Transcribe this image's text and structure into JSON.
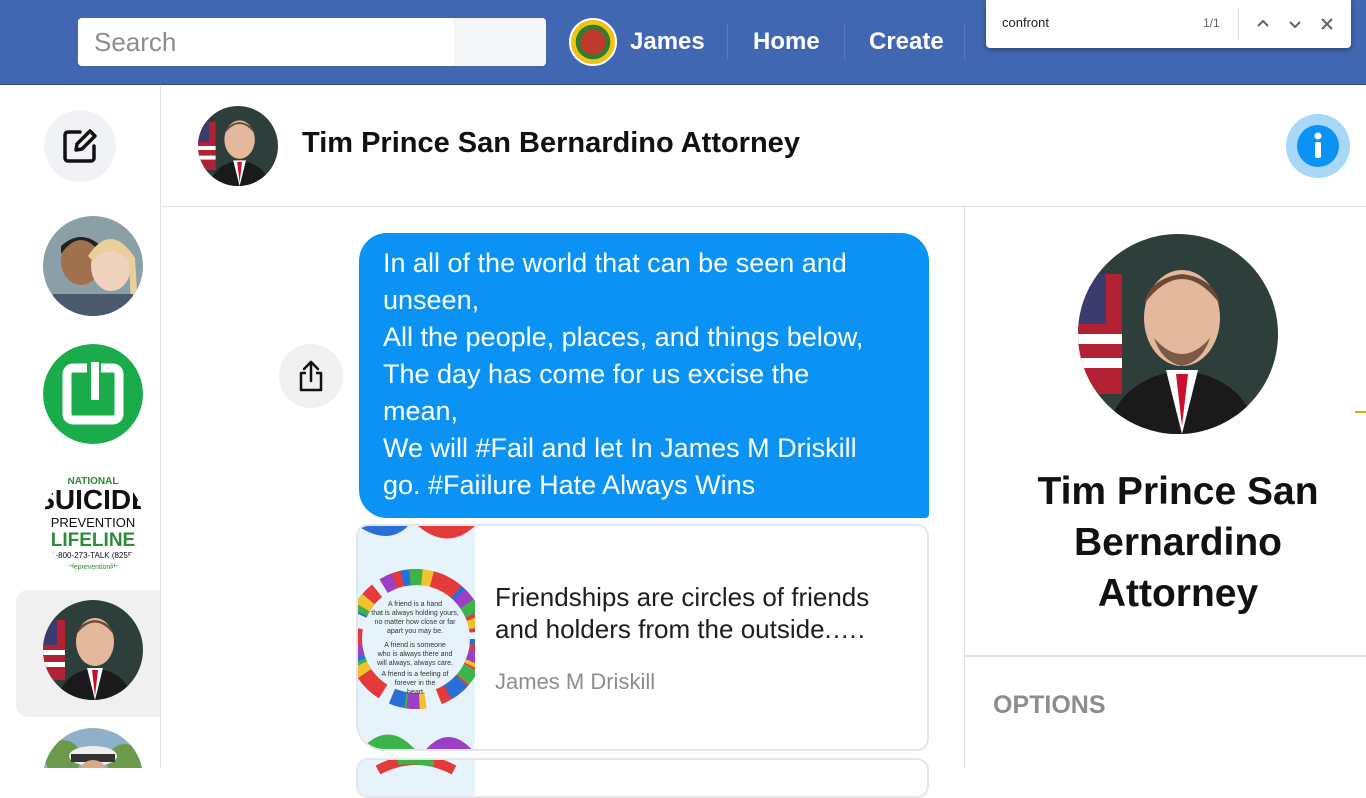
{
  "topbar": {
    "search": {
      "placeholder": "Search",
      "value": ""
    },
    "user_name": "James",
    "home_label": "Home",
    "create_label": "Create"
  },
  "find_bar": {
    "query": "confront",
    "count": "1/1"
  },
  "conversation": {
    "title": "Tim Prince San Bernardino Attorney",
    "message_lines": [
      "In all of the world that can be seen and",
      "unseen,",
      "All the people, places, and things below,",
      "The day has come for us excise the",
      "mean,",
      "We will #Fail and let In James M Driskill",
      "go.  #Faiilure Hate Always Wins"
    ],
    "link_card": {
      "title": "Friendships are circles of friends and holders from the outside.….",
      "author": "James M Driskill",
      "image_text": [
        "A friend is a hand",
        "that is always holding yours,",
        "no matter how close or far",
        "apart you may be.",
        "A friend is someone",
        "who is always there and",
        "will always, always care.",
        "A friend is a feeling of",
        "forever in the",
        "heart."
      ]
    }
  },
  "right_panel": {
    "name": "Tim Prince San Bernardino Attorney",
    "options_label": "OPTIONS"
  },
  "left_rail": {
    "logo_lines": [
      "NATIONAL",
      "SUICIDE",
      "PREVENTION",
      "LIFELINE",
      "1-800-273-TALK (8255)",
      "suicidepreventionlifeline"
    ]
  },
  "colors": {
    "topbar": "#4267b2",
    "bubble": "#0a93f5",
    "info_button": "#a8d8f8",
    "green_logo": "#1aab4a"
  }
}
